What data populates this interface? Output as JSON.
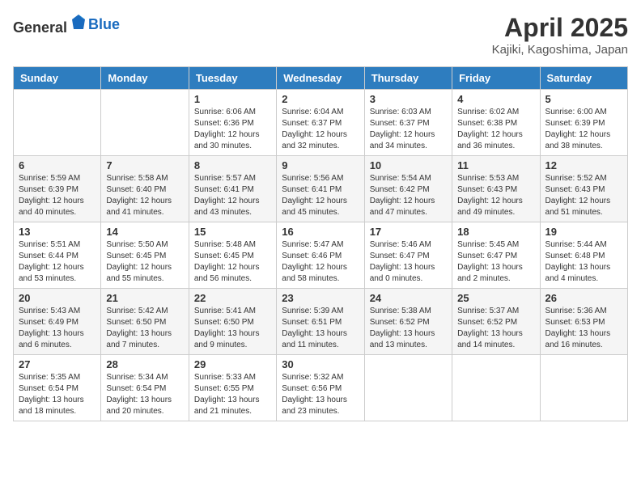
{
  "header": {
    "logo_general": "General",
    "logo_blue": "Blue",
    "month_title": "April 2025",
    "location": "Kajiki, Kagoshima, Japan"
  },
  "weekdays": [
    "Sunday",
    "Monday",
    "Tuesday",
    "Wednesday",
    "Thursday",
    "Friday",
    "Saturday"
  ],
  "weeks": [
    [
      {
        "day": "",
        "info": ""
      },
      {
        "day": "",
        "info": ""
      },
      {
        "day": "1",
        "info": "Sunrise: 6:06 AM\nSunset: 6:36 PM\nDaylight: 12 hours and 30 minutes."
      },
      {
        "day": "2",
        "info": "Sunrise: 6:04 AM\nSunset: 6:37 PM\nDaylight: 12 hours and 32 minutes."
      },
      {
        "day": "3",
        "info": "Sunrise: 6:03 AM\nSunset: 6:37 PM\nDaylight: 12 hours and 34 minutes."
      },
      {
        "day": "4",
        "info": "Sunrise: 6:02 AM\nSunset: 6:38 PM\nDaylight: 12 hours and 36 minutes."
      },
      {
        "day": "5",
        "info": "Sunrise: 6:00 AM\nSunset: 6:39 PM\nDaylight: 12 hours and 38 minutes."
      }
    ],
    [
      {
        "day": "6",
        "info": "Sunrise: 5:59 AM\nSunset: 6:39 PM\nDaylight: 12 hours and 40 minutes."
      },
      {
        "day": "7",
        "info": "Sunrise: 5:58 AM\nSunset: 6:40 PM\nDaylight: 12 hours and 41 minutes."
      },
      {
        "day": "8",
        "info": "Sunrise: 5:57 AM\nSunset: 6:41 PM\nDaylight: 12 hours and 43 minutes."
      },
      {
        "day": "9",
        "info": "Sunrise: 5:56 AM\nSunset: 6:41 PM\nDaylight: 12 hours and 45 minutes."
      },
      {
        "day": "10",
        "info": "Sunrise: 5:54 AM\nSunset: 6:42 PM\nDaylight: 12 hours and 47 minutes."
      },
      {
        "day": "11",
        "info": "Sunrise: 5:53 AM\nSunset: 6:43 PM\nDaylight: 12 hours and 49 minutes."
      },
      {
        "day": "12",
        "info": "Sunrise: 5:52 AM\nSunset: 6:43 PM\nDaylight: 12 hours and 51 minutes."
      }
    ],
    [
      {
        "day": "13",
        "info": "Sunrise: 5:51 AM\nSunset: 6:44 PM\nDaylight: 12 hours and 53 minutes."
      },
      {
        "day": "14",
        "info": "Sunrise: 5:50 AM\nSunset: 6:45 PM\nDaylight: 12 hours and 55 minutes."
      },
      {
        "day": "15",
        "info": "Sunrise: 5:48 AM\nSunset: 6:45 PM\nDaylight: 12 hours and 56 minutes."
      },
      {
        "day": "16",
        "info": "Sunrise: 5:47 AM\nSunset: 6:46 PM\nDaylight: 12 hours and 58 minutes."
      },
      {
        "day": "17",
        "info": "Sunrise: 5:46 AM\nSunset: 6:47 PM\nDaylight: 13 hours and 0 minutes."
      },
      {
        "day": "18",
        "info": "Sunrise: 5:45 AM\nSunset: 6:47 PM\nDaylight: 13 hours and 2 minutes."
      },
      {
        "day": "19",
        "info": "Sunrise: 5:44 AM\nSunset: 6:48 PM\nDaylight: 13 hours and 4 minutes."
      }
    ],
    [
      {
        "day": "20",
        "info": "Sunrise: 5:43 AM\nSunset: 6:49 PM\nDaylight: 13 hours and 6 minutes."
      },
      {
        "day": "21",
        "info": "Sunrise: 5:42 AM\nSunset: 6:50 PM\nDaylight: 13 hours and 7 minutes."
      },
      {
        "day": "22",
        "info": "Sunrise: 5:41 AM\nSunset: 6:50 PM\nDaylight: 13 hours and 9 minutes."
      },
      {
        "day": "23",
        "info": "Sunrise: 5:39 AM\nSunset: 6:51 PM\nDaylight: 13 hours and 11 minutes."
      },
      {
        "day": "24",
        "info": "Sunrise: 5:38 AM\nSunset: 6:52 PM\nDaylight: 13 hours and 13 minutes."
      },
      {
        "day": "25",
        "info": "Sunrise: 5:37 AM\nSunset: 6:52 PM\nDaylight: 13 hours and 14 minutes."
      },
      {
        "day": "26",
        "info": "Sunrise: 5:36 AM\nSunset: 6:53 PM\nDaylight: 13 hours and 16 minutes."
      }
    ],
    [
      {
        "day": "27",
        "info": "Sunrise: 5:35 AM\nSunset: 6:54 PM\nDaylight: 13 hours and 18 minutes."
      },
      {
        "day": "28",
        "info": "Sunrise: 5:34 AM\nSunset: 6:54 PM\nDaylight: 13 hours and 20 minutes."
      },
      {
        "day": "29",
        "info": "Sunrise: 5:33 AM\nSunset: 6:55 PM\nDaylight: 13 hours and 21 minutes."
      },
      {
        "day": "30",
        "info": "Sunrise: 5:32 AM\nSunset: 6:56 PM\nDaylight: 13 hours and 23 minutes."
      },
      {
        "day": "",
        "info": ""
      },
      {
        "day": "",
        "info": ""
      },
      {
        "day": "",
        "info": ""
      }
    ]
  ]
}
